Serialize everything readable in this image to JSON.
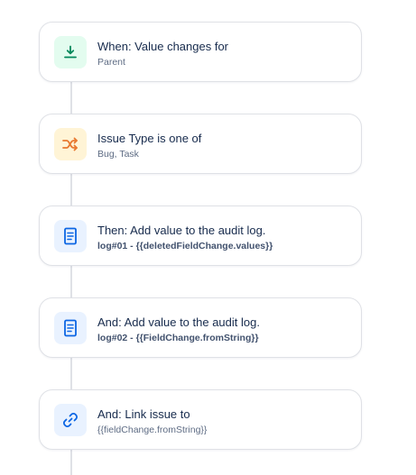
{
  "flow": {
    "steps": [
      {
        "title": "When: Value changes for",
        "subtitle": "Parent",
        "icon": "field-download-icon",
        "icon_bg": "#e3fcef",
        "icon_color": "#00875a"
      },
      {
        "title": "Issue Type is one of",
        "subtitle": "Bug, Task",
        "icon": "shuffle-icon",
        "icon_bg": "#fff4d6",
        "icon_color": "#e8782f"
      },
      {
        "title": "Then: Add value to the audit log.",
        "subtitle": "log#01 - {{deletedFieldChange.values}}",
        "icon": "document-icon",
        "icon_bg": "#e9f2ff",
        "icon_color": "#0c66e4"
      },
      {
        "title": "And: Add value to the audit log.",
        "subtitle": "log#02 - {{FieldChange.fromString}}",
        "icon": "document-icon",
        "icon_bg": "#e9f2ff",
        "icon_color": "#0c66e4"
      },
      {
        "title": "And: Link issue to",
        "subtitle": "{{fieldChange.fromString}}",
        "icon": "link-icon",
        "icon_bg": "#e9f2ff",
        "icon_color": "#0c66e4"
      }
    ]
  },
  "colors": {
    "connector": "#dfe1e6",
    "card_border": "#dfe1e6",
    "title_text": "#172b4d",
    "subtitle_text": "#5e6c84"
  }
}
